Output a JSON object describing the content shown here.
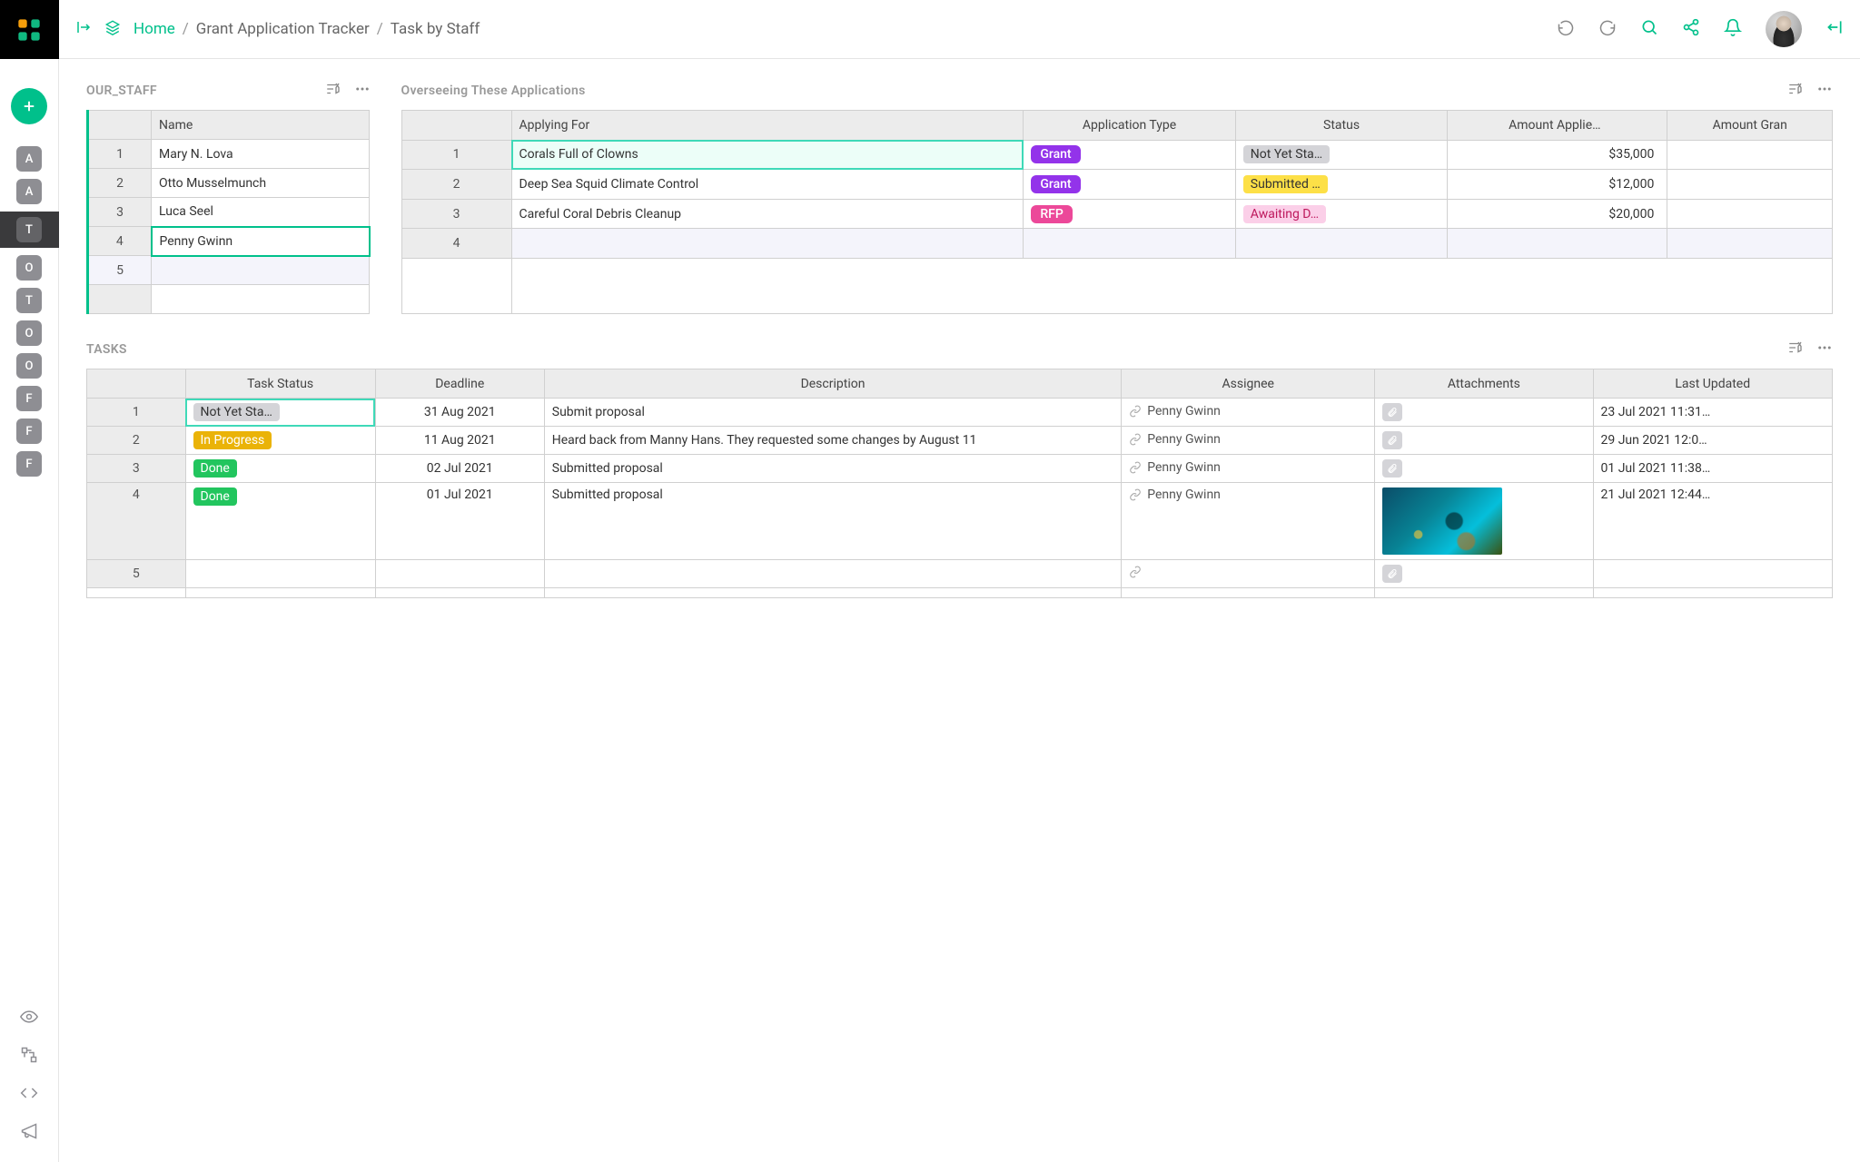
{
  "breadcrumbs": {
    "home": "Home",
    "mid": "Grant Application Tracker",
    "leaf": "Task by Staff"
  },
  "sidebar": {
    "items": [
      {
        "label": "A"
      },
      {
        "label": "A"
      },
      {
        "label": "T"
      },
      {
        "label": "O"
      },
      {
        "label": "T"
      },
      {
        "label": "O"
      },
      {
        "label": "O"
      },
      {
        "label": "F"
      },
      {
        "label": "F"
      },
      {
        "label": "F"
      }
    ],
    "active_index": 2
  },
  "staff": {
    "title": "OUR_STAFF",
    "header": "Name",
    "rows": [
      {
        "num": "1",
        "name": "Mary N. Lova"
      },
      {
        "num": "2",
        "name": "Otto Musselmunch"
      },
      {
        "num": "3",
        "name": "Luca Seel"
      },
      {
        "num": "4",
        "name": "Penny Gwinn"
      },
      {
        "num": "5",
        "name": ""
      }
    ],
    "selected_index": 3
  },
  "applications": {
    "title": "Overseeing These Applications",
    "headers": {
      "applying": "Applying For",
      "apptype": "Application Type",
      "status": "Status",
      "amt": "Amount Applie…",
      "amt2": "Amount Gran"
    },
    "rows": [
      {
        "num": "1",
        "applying": "Corals Full of Clowns",
        "type": "Grant",
        "type_class": "pill-grant",
        "status": "Not Yet Sta…",
        "status_class": "st-notstarted",
        "amount": "$35,000"
      },
      {
        "num": "2",
        "applying": "Deep Sea Squid Climate Control",
        "type": "Grant",
        "type_class": "pill-grant",
        "status": "Submitted …",
        "status_class": "st-submitted",
        "amount": "$12,000"
      },
      {
        "num": "3",
        "applying": "Careful Coral Debris Cleanup",
        "type": "RFP",
        "type_class": "pill-rfp",
        "status": "Awaiting D…",
        "status_class": "st-awaiting",
        "amount": "$20,000"
      },
      {
        "num": "4",
        "applying": "",
        "type": "",
        "type_class": "",
        "status": "",
        "status_class": "",
        "amount": ""
      }
    ],
    "selected_index": 0
  },
  "tasks": {
    "title": "TASKS",
    "headers": {
      "status": "Task Status",
      "deadline": "Deadline",
      "desc": "Description",
      "assignee": "Assignee",
      "attach": "Attachments",
      "updated": "Last Updated"
    },
    "rows": [
      {
        "num": "1",
        "status": "Not Yet Sta…",
        "status_class": "st-notstarted",
        "deadline": "31 Aug 2021",
        "desc": "Submit proposal",
        "assignee": "Penny Gwinn",
        "attach": "clip",
        "updated": "23 Jul 2021 11:31…"
      },
      {
        "num": "2",
        "status": "In Progress",
        "status_class": "st-inprogress",
        "deadline": "11 Aug 2021",
        "desc": "Heard back from Manny Hans. They requested some changes by August 11",
        "assignee": "Penny Gwinn",
        "attach": "clip",
        "updated": "29 Jun 2021 12:0…"
      },
      {
        "num": "3",
        "status": "Done",
        "status_class": "st-done",
        "deadline": "02 Jul 2021",
        "desc": "Submitted proposal",
        "assignee": "Penny Gwinn",
        "attach": "clip",
        "updated": "01 Jul 2021 11:38…"
      },
      {
        "num": "4",
        "status": "Done",
        "status_class": "st-done",
        "deadline": "01 Jul 2021",
        "desc": "Submitted proposal",
        "assignee": "Penny Gwinn",
        "attach": "image",
        "updated": "21 Jul 2021 12:44…"
      },
      {
        "num": "5",
        "status": "",
        "status_class": "",
        "deadline": "",
        "desc": "",
        "assignee": "",
        "attach": "clip-empty",
        "updated": ""
      }
    ],
    "selected_index": 0
  }
}
